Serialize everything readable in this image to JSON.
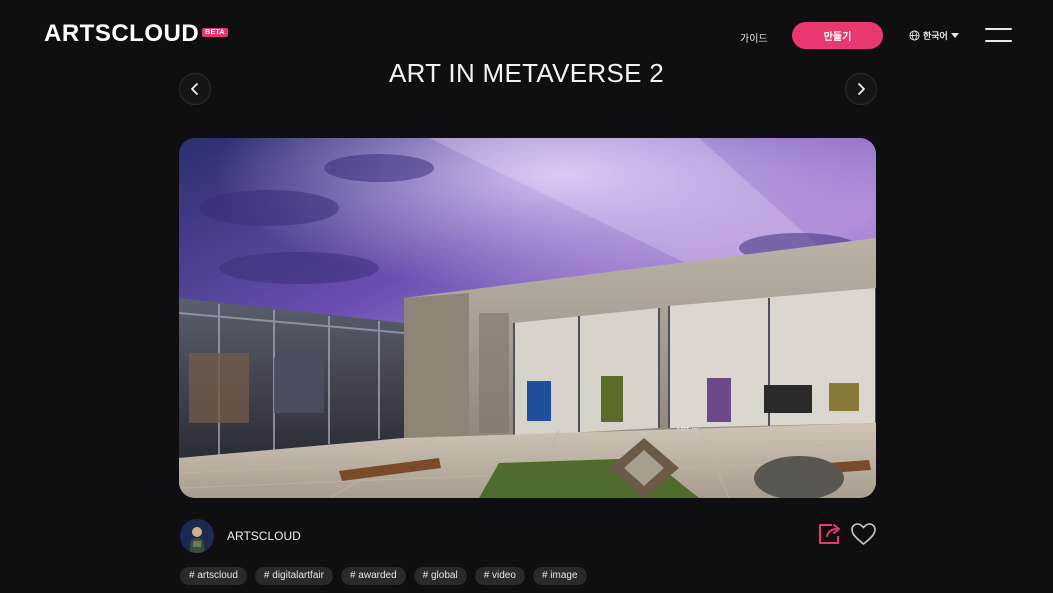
{
  "header": {
    "logo_text": "ARTSCLOUD",
    "logo_badge": "BETA",
    "guide_label": "가이드",
    "create_label": "만들기",
    "language_label": "한국어",
    "accent_color": "#e8386f"
  },
  "gallery": {
    "title": "ART IN METAVERSE 2",
    "hero_sign_text": "ART in METAVERSE 2"
  },
  "author": {
    "name": "ARTSCLOUD"
  },
  "tags": [
    "# artscloud",
    "# digitalartfair",
    "# awarded",
    "# global",
    "# video",
    "# image"
  ],
  "icons": {
    "prev": "chevron-left-icon",
    "next": "chevron-right-icon",
    "language": "globe-icon",
    "dropdown": "caret-down-icon",
    "menu": "hamburger-menu-icon",
    "share": "share-icon",
    "like": "heart-icon"
  }
}
